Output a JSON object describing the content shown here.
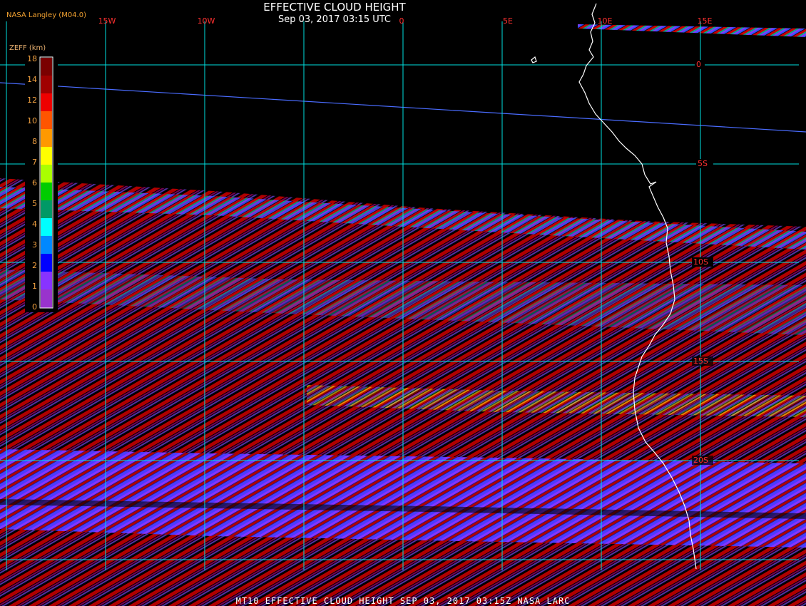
{
  "header": {
    "credit": "NASA Langley (M04.0)",
    "title": "EFFECTIVE CLOUD HEIGHT",
    "subtitle": "Sep 03, 2017 03:15 UTC"
  },
  "footer": {
    "caption": "MT10  EFFECTIVE CLOUD HEIGHT   SEP 03, 2017 03:15Z   NASA LARC"
  },
  "colorbar": {
    "label": "ZEFF (km)",
    "ticks": [
      "18",
      "14",
      "12",
      "10",
      "8",
      "7",
      "6",
      "5",
      "4",
      "3",
      "2",
      "1",
      "0"
    ],
    "colors": [
      "#7a0000",
      "#a00000",
      "#ee0000",
      "#ff5500",
      "#ff9900",
      "#ffff00",
      "#aaff00",
      "#00cc00",
      "#009966",
      "#00ffff",
      "#0088ff",
      "#0000ff",
      "#8833ff",
      "#9933cc"
    ]
  },
  "map": {
    "projection_grid": "5 degree lat/lon",
    "longitude_labels": [
      "15W",
      "10W",
      "0",
      "5E",
      "10E",
      "15E"
    ],
    "latitude_labels": [
      "0",
      "5S",
      "10S",
      "15S",
      "20S"
    ],
    "colors": {
      "grid": "#00e0e0",
      "coastline": "#ffffff",
      "labels": "#ff3030",
      "background": "#000000",
      "swath_red": "#b00000",
      "swath_blue": "#4a3cff",
      "swath_purple": "#8833ff"
    }
  }
}
